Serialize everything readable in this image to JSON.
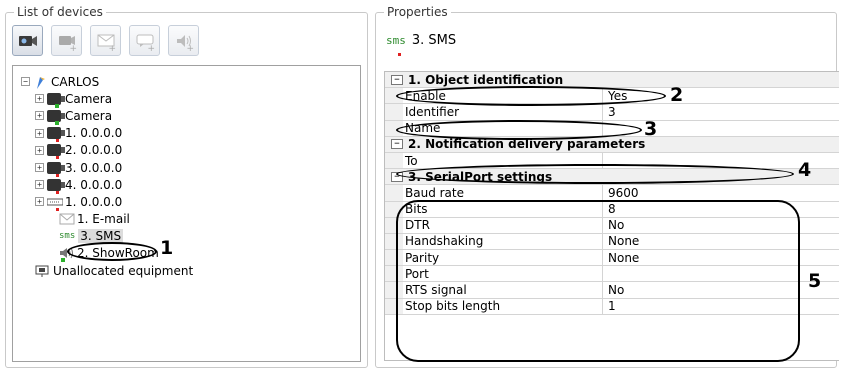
{
  "left_panel": {
    "title": "List of devices",
    "toolbar": [
      {
        "name": "add-camera-icon",
        "enabled": true
      },
      {
        "name": "add-device-icon",
        "enabled": false
      },
      {
        "name": "add-email-icon",
        "enabled": false
      },
      {
        "name": "add-sms-icon",
        "enabled": false
      },
      {
        "name": "add-sound-icon",
        "enabled": false
      }
    ],
    "tree": [
      {
        "label": "CARLOS",
        "level": 0,
        "icon": "server-icon"
      },
      {
        "label": "Camera",
        "level": 1,
        "icon": "camera-icon"
      },
      {
        "label": "Camera",
        "level": 1,
        "icon": "camera-icon"
      },
      {
        "label": "1. 0.0.0.0",
        "level": 1,
        "icon": "camera-icon"
      },
      {
        "label": "2. 0.0.0.0",
        "level": 1,
        "icon": "camera-icon"
      },
      {
        "label": "3. 0.0.0.0",
        "level": 1,
        "icon": "camera-icon"
      },
      {
        "label": "4. 0.0.0.0",
        "level": 1,
        "icon": "camera-icon"
      },
      {
        "label": "1. 0.0.0.0",
        "level": 1,
        "icon": "io-board-icon"
      },
      {
        "label": "1. E-mail",
        "level": 2,
        "icon": "email-icon"
      },
      {
        "label": "3. SMS",
        "level": 2,
        "icon": "sms-icon",
        "selected": true
      },
      {
        "label": "2. ShowRoom",
        "level": 2,
        "icon": "speaker-icon"
      },
      {
        "label": "Unallocated equipment",
        "level": 0,
        "icon": "unallocated-icon"
      }
    ],
    "sms_icon_text": "sms"
  },
  "right_panel": {
    "title": "Properties",
    "object_icon_text": "sms",
    "object_title": "3. SMS",
    "categories": [
      {
        "title": "1. Object identification",
        "rows": [
          {
            "name": "Enable",
            "value": "Yes"
          },
          {
            "name": "Identifier",
            "value": "3"
          },
          {
            "name": "Name",
            "value": ""
          }
        ]
      },
      {
        "title": "2. Notification delivery parameters",
        "rows": [
          {
            "name": "To",
            "value": ""
          }
        ]
      },
      {
        "title": "3. SerialPort settings",
        "rows": [
          {
            "name": "Baud rate",
            "value": "9600"
          },
          {
            "name": "Bits",
            "value": "8"
          },
          {
            "name": "DTR",
            "value": "No"
          },
          {
            "name": "Handshaking",
            "value": "None"
          },
          {
            "name": "Parity",
            "value": "None"
          },
          {
            "name": "Port",
            "value": ""
          },
          {
            "name": "RTS signal",
            "value": "No"
          },
          {
            "name": "Stop bits length",
            "value": "1"
          }
        ]
      }
    ]
  },
  "annotations": {
    "n1": "1",
    "n2": "2",
    "n3": "3",
    "n4": "4",
    "n5": "5"
  },
  "colors": {
    "sms_green": "#2d8a2d",
    "status_red": "#e02020",
    "status_green": "#2cb02c"
  }
}
